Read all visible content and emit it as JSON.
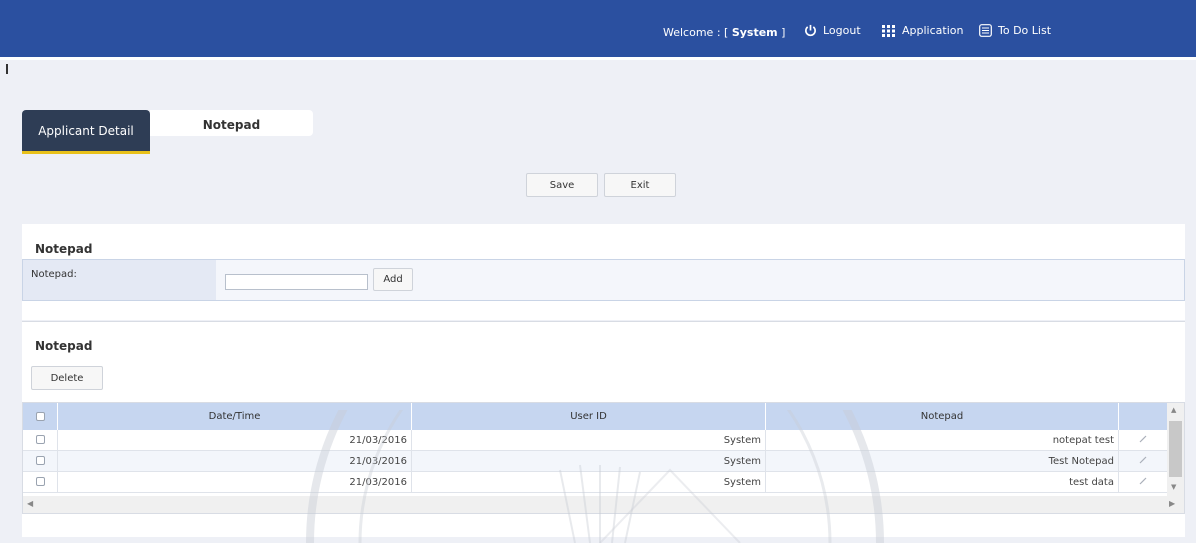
{
  "header": {
    "welcome_prefix": "Welcome : [",
    "welcome_user": "System",
    "welcome_suffix": "]",
    "logout": "Logout",
    "application": "Application",
    "todo": "To Do List"
  },
  "tabs": [
    {
      "label": "Applicant Detail",
      "active": true
    },
    {
      "label": "Notepad",
      "active": false
    }
  ],
  "actions": {
    "save": "Save",
    "exit": "Exit"
  },
  "form": {
    "title": "Notepad",
    "label": "Notepad:",
    "value": "",
    "add": "Add"
  },
  "list": {
    "title": "Notepad",
    "delete": "Delete",
    "columns": [
      "Date/Time",
      "User ID",
      "Notepad"
    ],
    "rows": [
      {
        "date": "21/03/2016",
        "user": "System",
        "note": "notepat test"
      },
      {
        "date": "21/03/2016",
        "user": "System",
        "note": "Test Notepad"
      },
      {
        "date": "21/03/2016",
        "user": "System",
        "note": "test data"
      }
    ]
  },
  "colors": {
    "header_bg": "#2b50a0",
    "tab_active": "#2e3d55",
    "tab_accent": "#e8c11a",
    "grid_header": "#c6d6f0"
  },
  "icons": [
    "power-icon",
    "grid-dots-icon",
    "list-icon",
    "edit-pencil-icon"
  ]
}
